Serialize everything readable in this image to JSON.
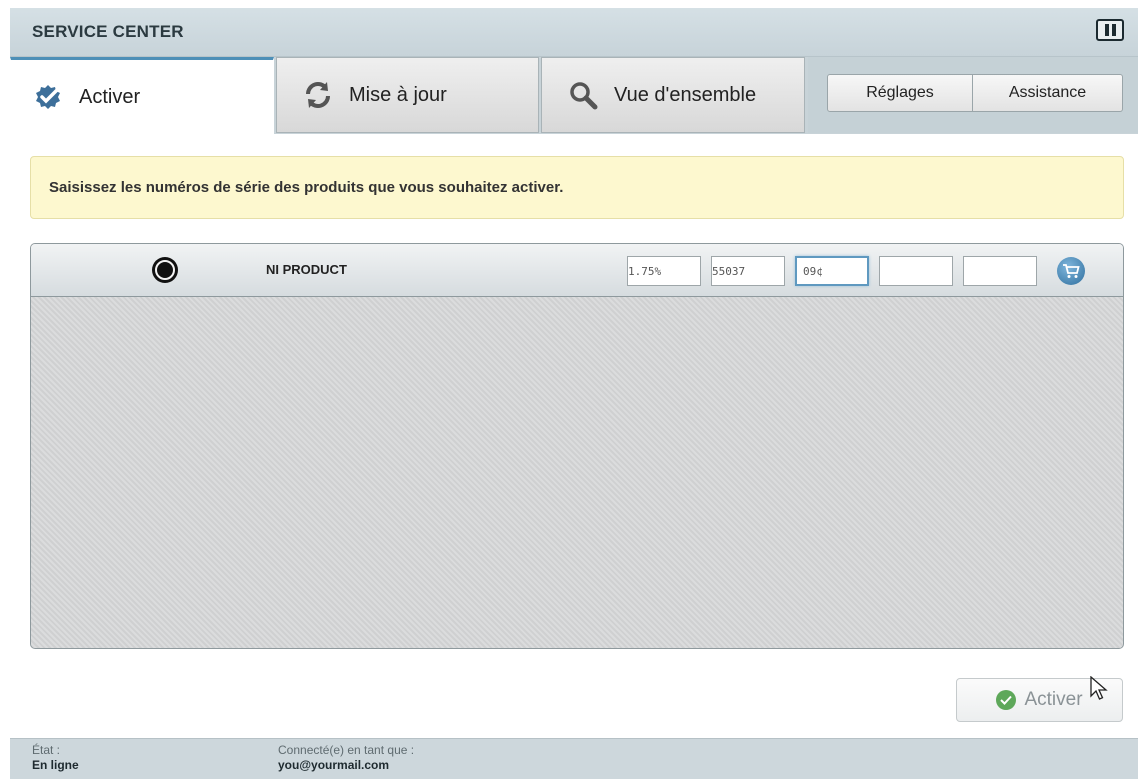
{
  "window": {
    "title": "SERVICE CENTER",
    "logo_icon": "ni-logo-icon"
  },
  "tabs": [
    {
      "label": "Activer",
      "icon": "check-badge-icon",
      "active": true
    },
    {
      "label": "Mise à jour",
      "icon": "refresh-icon",
      "active": false
    },
    {
      "label": "Vue d'ensemble",
      "icon": "magnifier-icon",
      "active": false
    }
  ],
  "header_buttons": {
    "settings_label": "Réglages",
    "support_label": "Assistance"
  },
  "info_message": "Saisissez les numéros de série des produits que vous souhaitez activer.",
  "product": {
    "name": "NI PRODUCT",
    "serial_fields": [
      "1.75%",
      "55037",
      "09¢",
      "",
      ""
    ],
    "cart_icon": "cart-icon"
  },
  "actions": {
    "activate_label": "Activer"
  },
  "status": {
    "state_label": "État :",
    "state_value": "En ligne",
    "user_label": "Connecté(e) en tant que :",
    "user_value": "you@yourmail.com"
  },
  "colors": {
    "accent": "#4d8fb7",
    "info_bg": "#fdf8cf",
    "success": "#5ea85a"
  }
}
